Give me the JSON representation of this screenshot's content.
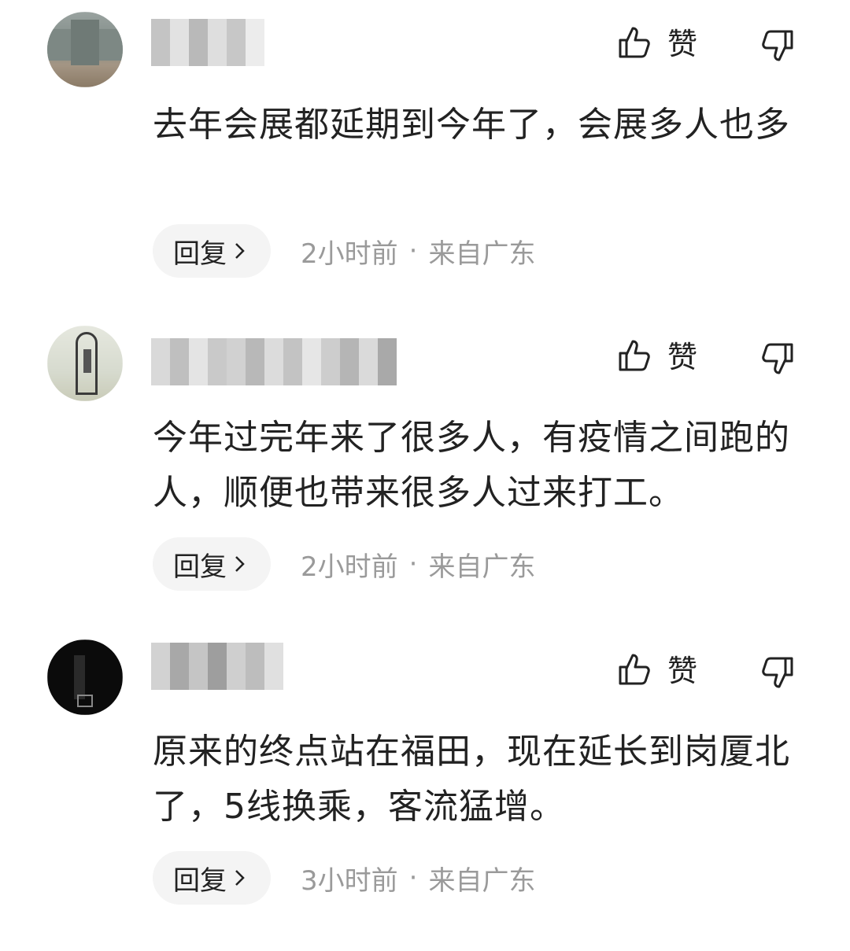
{
  "like_label": "赞",
  "reply_label": "回复",
  "separator": "·",
  "comments": [
    {
      "text": "去年会展都延期到今年了，会展多人也多",
      "time": "2小时前",
      "location": "来自广东"
    },
    {
      "text": "今年过完年来了很多人，有疫情之间跑的人，顺便也带来很多人过来打工。",
      "time": "2小时前",
      "location": "来自广东"
    },
    {
      "text": "原来的终点站在福田，现在延长到岗厦北了，5线换乘，客流猛增。",
      "time": "3小时前",
      "location": "来自广东"
    }
  ],
  "icons": {
    "like": "thumbs-up-icon",
    "dislike": "thumbs-down-icon",
    "reply_arrow": "chevron-right-icon"
  }
}
